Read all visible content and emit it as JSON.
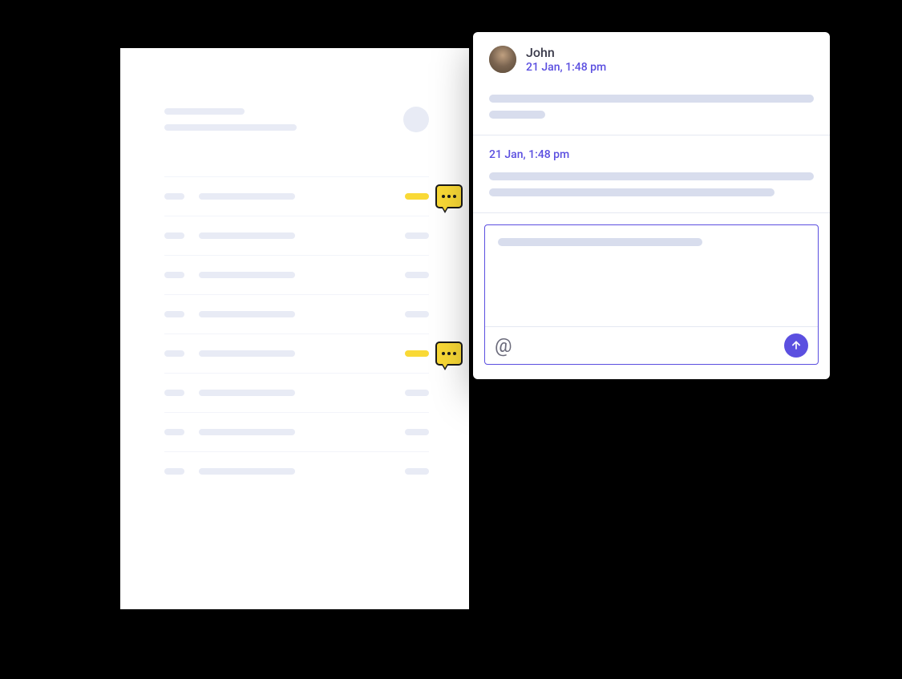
{
  "comment": {
    "author_name": "John",
    "timestamp": "21 Jan, 1:48 pm"
  },
  "reply": {
    "timestamp": "21 Jan, 1:48 pm"
  },
  "compose": {
    "mention_symbol": "@"
  },
  "document": {
    "rows": [
      {
        "hasComment": true,
        "highlighted": true
      },
      {
        "hasComment": false,
        "highlighted": false
      },
      {
        "hasComment": false,
        "highlighted": false
      },
      {
        "hasComment": false,
        "highlighted": false
      },
      {
        "hasComment": true,
        "highlighted": true
      },
      {
        "hasComment": false,
        "highlighted": false
      },
      {
        "hasComment": false,
        "highlighted": false
      },
      {
        "hasComment": false,
        "highlighted": false
      }
    ]
  },
  "colors": {
    "accent": "#5B4FE0",
    "highlight": "#F9D936",
    "skeleton": "#E8EBF5"
  }
}
